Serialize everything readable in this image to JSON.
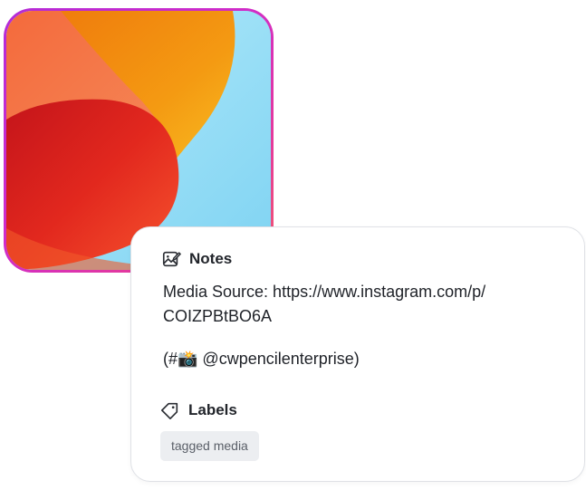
{
  "media": {
    "border_gradient": [
      "#b32bd8",
      "#e43a9b"
    ],
    "colors": {
      "sky": "#8fd9f4",
      "orange": "#f08a10",
      "amber": "#f7b21a",
      "coral": "#f2644a",
      "red": "#e0261c"
    }
  },
  "notes": {
    "icon": "edit-image-icon",
    "title": "Notes",
    "source_line_1": "Media Source: https://www.instagram.com/p/",
    "source_line_2": "COIZPBtBO6A",
    "credit_line": "(#📸 @cwpencilenterprise)"
  },
  "labels": {
    "icon": "tag-icon",
    "title": "Labels",
    "items": [
      {
        "label": "tagged media"
      }
    ]
  }
}
